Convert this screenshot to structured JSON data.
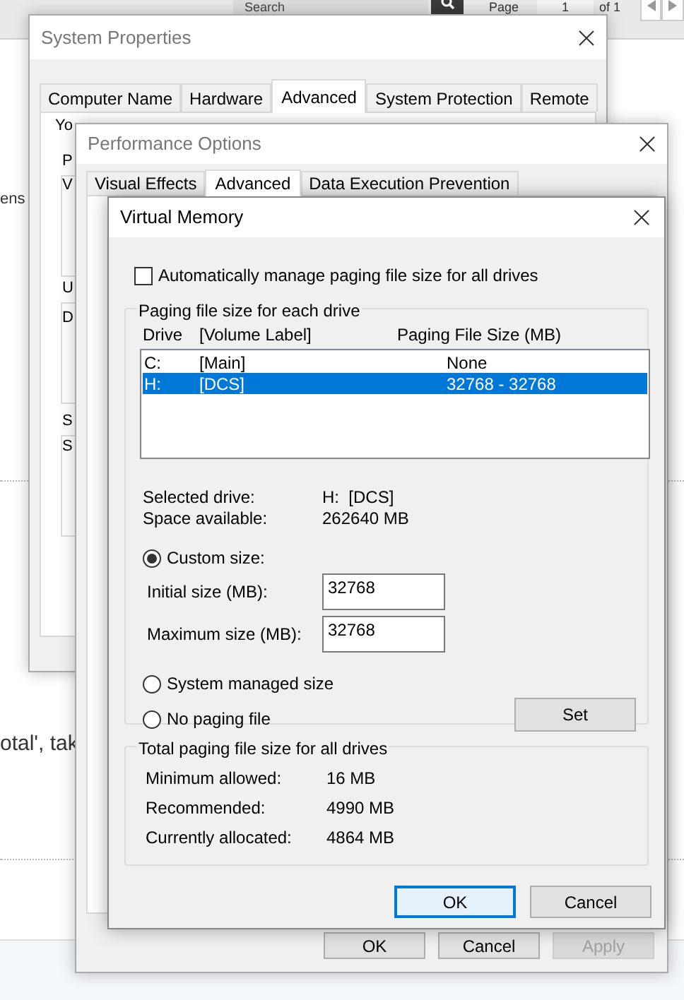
{
  "background_page": {
    "search": {
      "placeholder": "Search"
    },
    "page_label": "Page",
    "page_number": "1",
    "page_count": "of 1",
    "text_fragments": [
      "ens",
      "otal', tak"
    ]
  },
  "system_properties": {
    "title": "System Properties",
    "tabs": [
      {
        "label": "Computer Name",
        "selected": false
      },
      {
        "label": "Hardware",
        "selected": false
      },
      {
        "label": "Advanced",
        "selected": true
      },
      {
        "label": "System Protection",
        "selected": false
      },
      {
        "label": "Remote",
        "selected": false
      }
    ],
    "text_fragments": [
      "Yo",
      "P",
      "V",
      "U",
      "D",
      "S",
      "S"
    ]
  },
  "performance_options": {
    "title": "Performance Options",
    "tabs": [
      {
        "label": "Visual Effects",
        "selected": false
      },
      {
        "label": "Advanced",
        "selected": true
      },
      {
        "label": "Data Execution Prevention",
        "selected": false
      }
    ],
    "buttons": [
      {
        "label": "OK",
        "disabled": false
      },
      {
        "label": "Cancel",
        "disabled": false
      },
      {
        "label": "Apply",
        "disabled": true
      }
    ]
  },
  "virtual_memory": {
    "title": "Virtual Memory",
    "auto_manage": {
      "label": "Automatically manage paging file size for all drives",
      "checked": false
    },
    "drive_group": {
      "title": "Paging file size for each drive",
      "columns": [
        "Drive",
        "[Volume Label]",
        "Paging File Size (MB)"
      ],
      "drives": [
        {
          "drive": "C:",
          "label": "[Main]",
          "size": "None",
          "selected": false
        },
        {
          "drive": "H:",
          "label": "[DCS]",
          "size": "32768 - 32768",
          "selected": true
        }
      ],
      "info": [
        {
          "label": "Selected drive:",
          "value": "H:  [DCS]"
        },
        {
          "label": "Space available:",
          "value": "262640 MB"
        }
      ],
      "size_options": [
        {
          "label": "Custom size:",
          "selected": true
        },
        {
          "label": "System managed size",
          "selected": false
        },
        {
          "label": "No paging file",
          "selected": false
        }
      ],
      "fields": [
        {
          "label": "Initial size (MB):",
          "value": "32768"
        },
        {
          "label": "Maximum size (MB):",
          "value": "32768"
        }
      ],
      "set_button": "Set"
    },
    "totals_group": {
      "title": "Total paging file size for all drives",
      "rows": [
        {
          "label": "Minimum allowed:",
          "value": "16 MB"
        },
        {
          "label": "Recommended:",
          "value": "4990 MB"
        },
        {
          "label": "Currently allocated:",
          "value": "4864 MB"
        }
      ]
    },
    "buttons": [
      {
        "label": "OK",
        "focused": true
      },
      {
        "label": "Cancel",
        "focused": false
      }
    ]
  }
}
